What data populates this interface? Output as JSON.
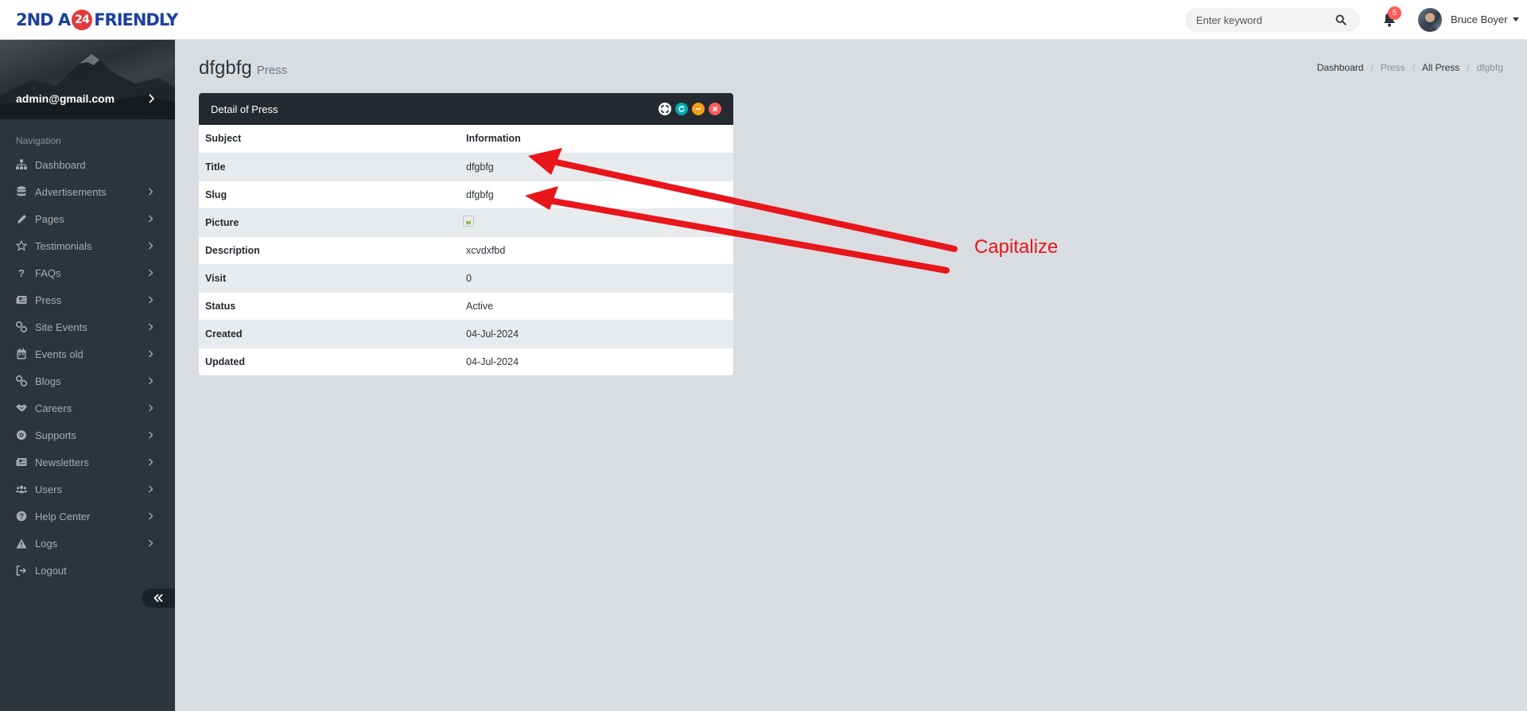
{
  "header": {
    "logo": {
      "part1": "2ND A",
      "badge": "24",
      "part2": "FRIENDLY"
    },
    "search_placeholder": "Enter keyword",
    "notification_count": "5",
    "user_name": "Bruce Boyer"
  },
  "sidebar": {
    "profile_email": "admin@gmail.com",
    "nav_header": "Navigation",
    "items": [
      {
        "label": "Dashboard",
        "icon": "sitemap-icon",
        "has_chevron": false
      },
      {
        "label": "Advertisements",
        "icon": "database-icon",
        "has_chevron": true
      },
      {
        "label": "Pages",
        "icon": "pencil-icon",
        "has_chevron": true
      },
      {
        "label": "Testimonials",
        "icon": "star-icon",
        "has_chevron": true
      },
      {
        "label": "FAQs",
        "icon": "question-icon",
        "has_chevron": true
      },
      {
        "label": "Press",
        "icon": "newspaper-icon",
        "has_chevron": true
      },
      {
        "label": "Site Events",
        "icon": "link-icon",
        "has_chevron": true
      },
      {
        "label": "Events old",
        "icon": "calendar-icon",
        "has_chevron": true
      },
      {
        "label": "Blogs",
        "icon": "link-icon",
        "has_chevron": true
      },
      {
        "label": "Careers",
        "icon": "handshake-icon",
        "has_chevron": true
      },
      {
        "label": "Supports",
        "icon": "support-icon",
        "has_chevron": true
      },
      {
        "label": "Newsletters",
        "icon": "newspaper-icon",
        "has_chevron": true
      },
      {
        "label": "Users",
        "icon": "users-icon",
        "has_chevron": true
      },
      {
        "label": "Help Center",
        "icon": "question-circle-icon",
        "has_chevron": true
      },
      {
        "label": "Logs",
        "icon": "warning-icon",
        "has_chevron": true
      },
      {
        "label": "Logout",
        "icon": "logout-icon",
        "has_chevron": false
      }
    ]
  },
  "page": {
    "title": "dfgbfg",
    "subtitle": "Press",
    "breadcrumb": [
      "Dashboard",
      "Press",
      "All Press",
      "dfgbfg"
    ]
  },
  "panel": {
    "title": "Detail of Press",
    "columns": [
      "Subject",
      "Information"
    ],
    "rows": [
      {
        "subject": "Title",
        "info": "dfgbfg"
      },
      {
        "subject": "Slug",
        "info": "dfgbfg"
      },
      {
        "subject": "Picture",
        "info": ""
      },
      {
        "subject": "Description",
        "info": "xcvdxfbd"
      },
      {
        "subject": "Visit",
        "info": "0"
      },
      {
        "subject": "Status",
        "info": "Active"
      },
      {
        "subject": "Created",
        "info": "04-Jul-2024"
      },
      {
        "subject": "Updated",
        "info": "04-Jul-2024"
      }
    ]
  },
  "annotation": {
    "text": "Capitalize",
    "color": "#e8151b"
  }
}
